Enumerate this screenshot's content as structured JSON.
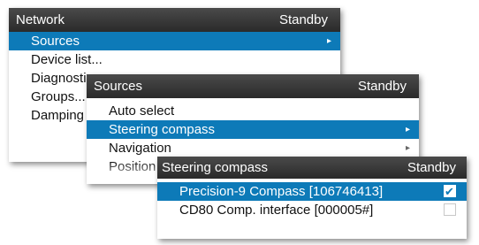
{
  "network_panel": {
    "title": "Network",
    "status": "Standby",
    "items": [
      {
        "label": "Sources",
        "selected": true
      },
      {
        "label": "Device list..."
      },
      {
        "label": "Diagnostics"
      },
      {
        "label": "Groups..."
      },
      {
        "label": "Damping"
      }
    ]
  },
  "sources_panel": {
    "title": "Sources",
    "status": "Standby",
    "items": [
      {
        "label": "Auto select"
      },
      {
        "label": "Steering compass",
        "selected": true
      },
      {
        "label": "Navigation"
      },
      {
        "label": "Position"
      }
    ]
  },
  "compass_panel": {
    "title": "Steering compass",
    "status": "Standby",
    "items": [
      {
        "label": "Precision-9 Compass [106746413]",
        "selected": true,
        "checked": true
      },
      {
        "label": "CD80 Comp. interface [000005#]",
        "checked": false
      }
    ]
  },
  "colors": {
    "accent": "#0d7ab8",
    "header": "#2f2f2f"
  }
}
